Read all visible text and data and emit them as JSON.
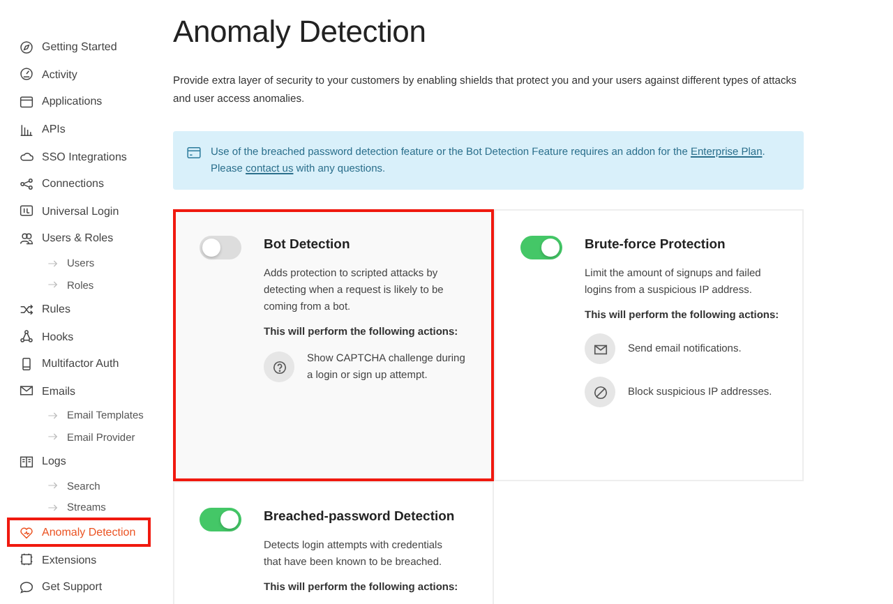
{
  "sidebar": {
    "items": [
      {
        "label": "Getting Started",
        "selected": false,
        "highlighted": false
      },
      {
        "label": "Activity",
        "selected": false,
        "highlighted": false
      },
      {
        "label": "Applications",
        "selected": false,
        "highlighted": false
      },
      {
        "label": "APIs",
        "selected": false,
        "highlighted": false
      },
      {
        "label": "SSO Integrations",
        "selected": false,
        "highlighted": false
      },
      {
        "label": "Connections",
        "selected": false,
        "highlighted": false
      },
      {
        "label": "Universal Login",
        "selected": false,
        "highlighted": false
      },
      {
        "label": "Users & Roles",
        "selected": false,
        "highlighted": false,
        "children": [
          {
            "label": "Users",
            "selected": false
          },
          {
            "label": "Roles",
            "selected": false
          }
        ]
      },
      {
        "label": "Rules",
        "selected": false,
        "highlighted": false
      },
      {
        "label": "Hooks",
        "selected": false,
        "highlighted": false
      },
      {
        "label": "Multifactor Auth",
        "selected": false,
        "highlighted": false
      },
      {
        "label": "Emails",
        "selected": false,
        "highlighted": false,
        "children": [
          {
            "label": "Email Templates",
            "selected": false
          },
          {
            "label": "Email Provider",
            "selected": false
          }
        ]
      },
      {
        "label": "Logs",
        "selected": false,
        "highlighted": false,
        "children": [
          {
            "label": "Search",
            "selected": false
          },
          {
            "label": "Streams",
            "selected": false
          }
        ]
      },
      {
        "label": "Anomaly Detection",
        "selected": true,
        "highlighted": true
      },
      {
        "label": "Extensions",
        "selected": false,
        "highlighted": false
      },
      {
        "label": "Get Support",
        "selected": false,
        "highlighted": false
      }
    ]
  },
  "page": {
    "title": "Anomaly Detection",
    "description": "Provide extra layer of security to your customers by enabling shields that protect you and your users against different types of attacks and user access anomalies."
  },
  "info": {
    "lines": [
      [
        {
          "kind": "text",
          "text": "Use of the breached password detection feature or the Bot Detection Feature requires an addon for the "
        },
        {
          "kind": "link",
          "text": "Enterprise Plan"
        },
        {
          "kind": "text",
          "text": "."
        }
      ],
      [
        {
          "kind": "text",
          "text": "Please "
        },
        {
          "kind": "link",
          "text": "contact us"
        },
        {
          "kind": "text",
          "text": " with any questions."
        }
      ]
    ]
  },
  "shields": [
    {
      "title": "Bot Detection",
      "on": false,
      "highlighted": true,
      "description": "Adds protection to scripted attacks by detecting when a request is likely to be coming from a bot.",
      "actions_heading": "This will perform the following actions:",
      "actions": [
        {
          "kind": "captcha",
          "text": "Show CAPTCHA challenge during a login or sign up attempt."
        }
      ]
    },
    {
      "title": "Brute-force Protection",
      "on": true,
      "highlighted": false,
      "description": "Limit the amount of signups and failed logins from a suspicious IP address.",
      "actions_heading": "This will perform the following actions:",
      "actions": [
        {
          "kind": "email",
          "text": "Send email notifications."
        },
        {
          "kind": "block",
          "text": "Block suspicious IP addresses."
        }
      ]
    },
    {
      "title": "Breached-password Detection",
      "on": true,
      "highlighted": false,
      "description": "Detects login attempts with credentials that have been known to be breached.",
      "actions_heading": "This will perform the following actions:"
    }
  ]
}
